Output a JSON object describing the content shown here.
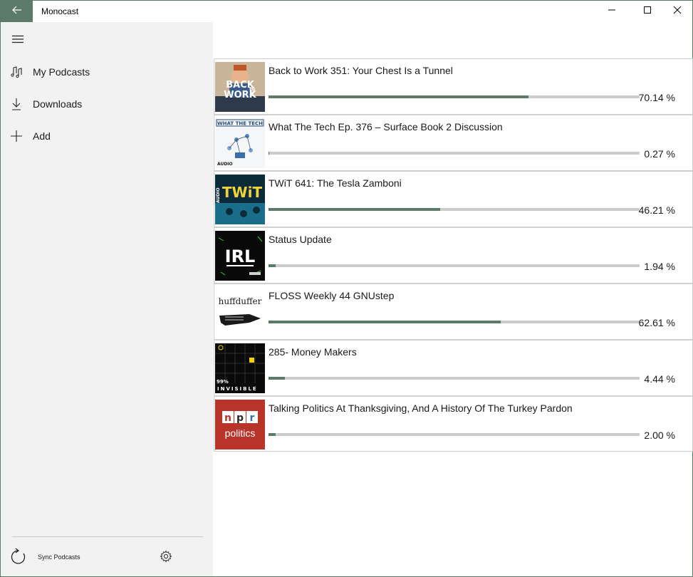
{
  "window": {
    "title": "Monocast",
    "accent": "#5c7a68"
  },
  "titlebar": {
    "back_icon": "arrow-left-icon",
    "min_icon": "minimize-icon",
    "max_icon": "maximize-icon",
    "close_icon": "close-icon"
  },
  "sidebar": {
    "menu_icon": "hamburger-icon",
    "items": [
      {
        "label": "My Podcasts",
        "icon": "music-notes-icon"
      },
      {
        "label": "Downloads",
        "icon": "download-arrow-icon"
      },
      {
        "label": "Add",
        "icon": "plus-icon"
      }
    ],
    "sync_label": "Sync Podcasts",
    "sync_icon": "refresh-icon",
    "settings_icon": "gear-icon"
  },
  "episodes": [
    {
      "title": "Back to Work 351: Your Chest Is a Tunnel",
      "progress": 70.14,
      "progress_text": "70.14 %",
      "art": {
        "line1": "BACK",
        "line2": "to",
        "line3": "WORK"
      }
    },
    {
      "title": "What The Tech Ep. 376 – Surface Book 2 Discussion",
      "progress": 0.27,
      "progress_text": "0.27 %",
      "art": {
        "line1": "WHAT THE TECH",
        "line2": "AUDIO"
      }
    },
    {
      "title": "TWiT 641: The Tesla Zamboni",
      "progress": 46.21,
      "progress_text": "46.21 %",
      "art": {
        "line1": "TWiT",
        "line2": "AUDIO"
      }
    },
    {
      "title": "Status Update",
      "progress": 1.94,
      "progress_text": "1.94 %",
      "art": {
        "line1": "IRL"
      }
    },
    {
      "title": "FLOSS Weekly 44 GNUstep",
      "progress": 62.61,
      "progress_text": "62.61 %",
      "art": {
        "line1": "huffduffer"
      }
    },
    {
      "title": "285- Money Makers",
      "progress": 4.44,
      "progress_text": "4.44 %",
      "art": {
        "line1": "99%",
        "line2": "INVISIBLE"
      }
    },
    {
      "title": "Talking Politics At Thanksgiving, And A History Of The Turkey Pardon",
      "progress": 2.0,
      "progress_text": "2.00 %",
      "art": {
        "line1": "n",
        "line2": "p",
        "line3": "r",
        "line4": "politics"
      }
    }
  ]
}
